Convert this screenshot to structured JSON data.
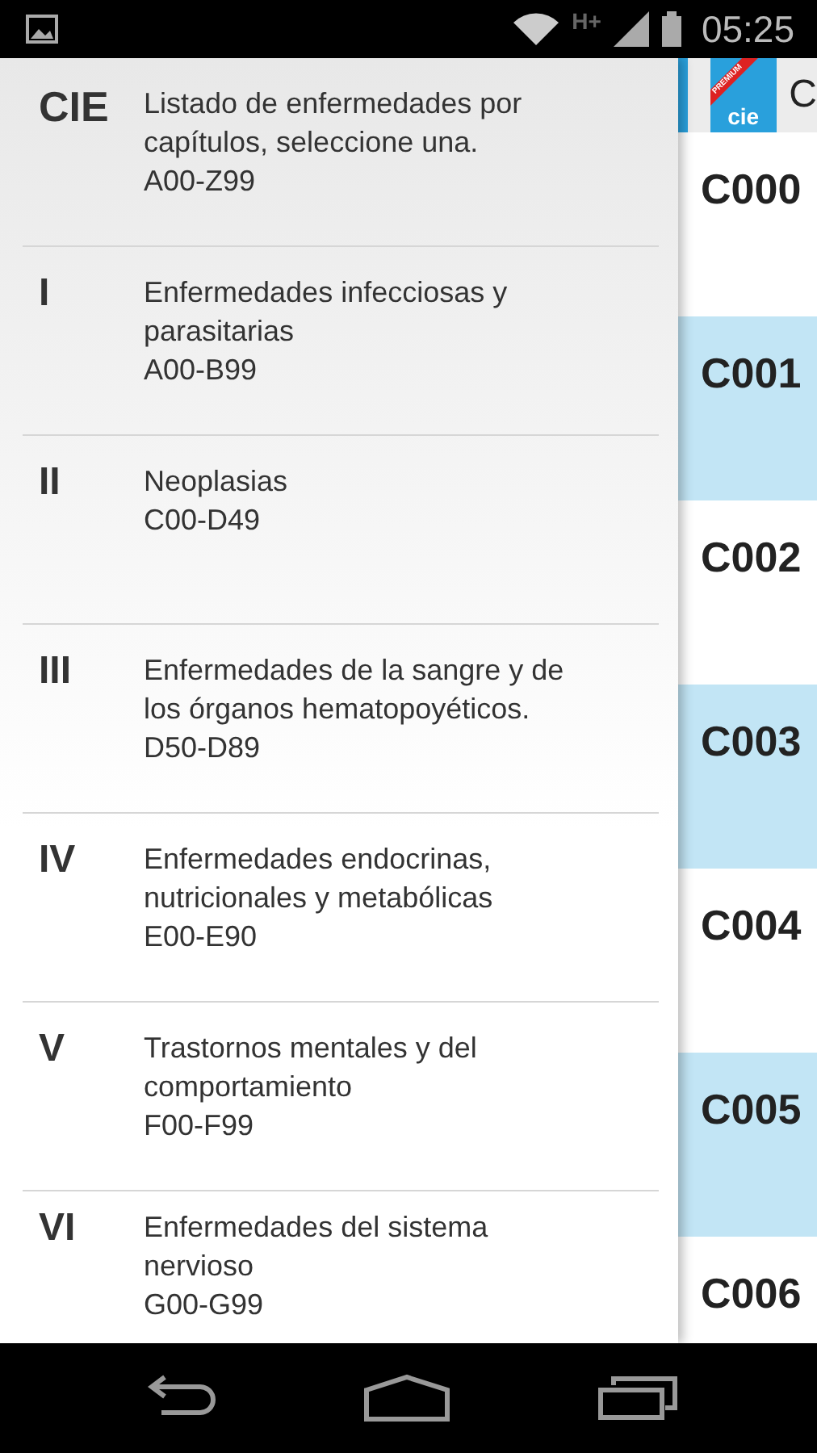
{
  "status_bar": {
    "time": "05:25",
    "network": "H+"
  },
  "header": {
    "badge": "PREMIUM",
    "logo": "cie",
    "title": "C"
  },
  "codes": [
    "C000",
    "C001",
    "C002",
    "C003",
    "C004",
    "C005",
    "C006"
  ],
  "drawer": {
    "items": [
      {
        "numeral": "CIE",
        "title": "Listado de enfermedades por capítulos, seleccione una.",
        "range": "A00-Z99"
      },
      {
        "numeral": "I",
        "title": "Enfermedades infecciosas y parasitarias",
        "range": "A00-B99"
      },
      {
        "numeral": "II",
        "title": "Neoplasias",
        "range": "C00-D49"
      },
      {
        "numeral": "III",
        "title": "Enfermedades de la sangre y de los órganos hematopoyéticos.",
        "range": "D50-D89"
      },
      {
        "numeral": "IV",
        "title": "Enfermedades endocrinas, nutricionales y metabólicas",
        "range": "E00-E90"
      },
      {
        "numeral": "V",
        "title": "Trastornos mentales y del comportamiento",
        "range": "F00-F99"
      },
      {
        "numeral": "VI",
        "title": "Enfermedades del sistema nervioso",
        "range": "G00-G99"
      }
    ]
  }
}
